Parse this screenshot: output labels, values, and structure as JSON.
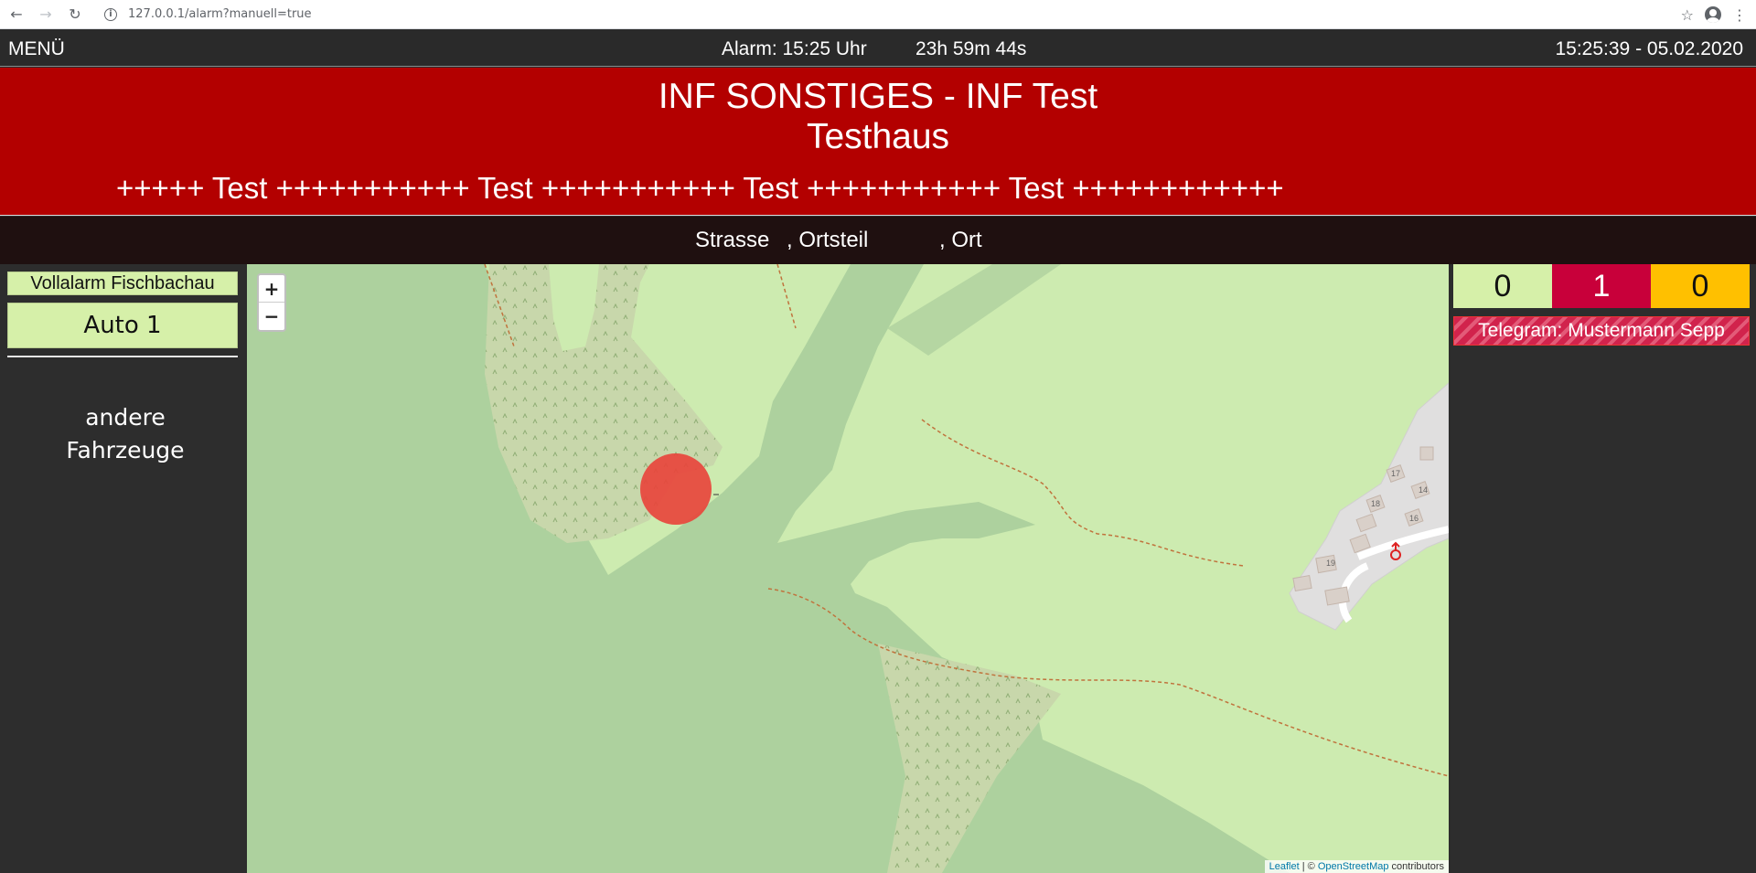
{
  "browser": {
    "url": "127.0.0.1/alarm?manuell=true",
    "icons": [
      "back-arrow-icon",
      "forward-arrow-icon",
      "reload-icon",
      "info-icon",
      "star-icon",
      "account-icon",
      "more-icon"
    ]
  },
  "topbar": {
    "menu": "MENÜ",
    "alarm_time": "Alarm: 15:25 Uhr",
    "countdown": "23h 59m 44s",
    "clock": "15:25:39 - 05.02.2020"
  },
  "banner": {
    "title": "INF SONSTIGES - INF Test",
    "object": "Testhaus",
    "ticker": "+++++ Test +++++++++++ Test +++++++++++ Test +++++++++++ Test ++++++++++++",
    "color": "#b30000"
  },
  "address": {
    "street": "Strasse",
    "district": ", Ortsteil",
    "town": ", Ort"
  },
  "left": {
    "alarm_group": "Vollalarm Fischbachau",
    "vehicle": "Auto 1",
    "other_vehicles_line1": "andere",
    "other_vehicles_line2": "Fahrzeuge"
  },
  "map": {
    "zoom_in": "+",
    "zoom_out": "−",
    "attribution_leaflet": "Leaflet",
    "attribution_sep": " | © ",
    "attribution_osm": "OpenStreetMap",
    "attribution_tail": " contributors",
    "house_numbers": [
      "17",
      "14",
      "18",
      "16",
      "19"
    ],
    "marker_color": "#e8453c"
  },
  "right": {
    "counters": [
      "0",
      "1",
      "0"
    ],
    "counter_colors": [
      "#d6f0a9",
      "#c8003a",
      "#ffc000"
    ],
    "telegram": "Telegram: Mustermann Sepp"
  }
}
